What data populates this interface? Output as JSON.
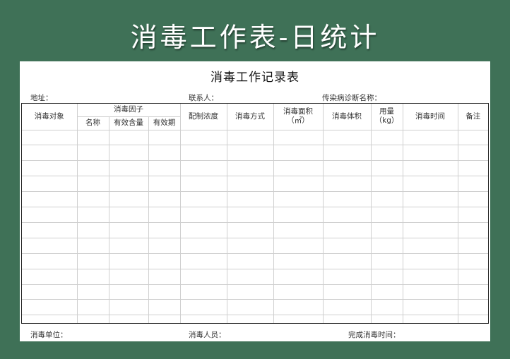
{
  "banner_title": "消毒工作表-日统计",
  "form": {
    "title": "消毒工作记录表",
    "address_label": "地址：",
    "contact_label": "联系人：",
    "disease_label": "传染病诊断名称：",
    "unit_label": "消毒单位：",
    "staff_label": "消毒人员：",
    "completion_time_label": "完成消毒时间："
  },
  "table": {
    "headers": {
      "target": "消毒对象",
      "factor": "消毒因子",
      "factor_name": "名称",
      "factor_content": "有效含量",
      "factor_expiry": "有效期",
      "concentration": "配制浓度",
      "method": "消毒方式",
      "area": "消毒面积",
      "area_unit": "（㎡）",
      "volume": "消毒体积",
      "dosage": "用量",
      "dosage_unit": "（kg）",
      "time": "消毒时间",
      "remarks": "备注"
    },
    "empty_row_count": 13
  },
  "colors": {
    "background": "#3f7157",
    "sheet": "#ffffff",
    "grid_line": "#cfcfcf",
    "border": "#222222"
  }
}
